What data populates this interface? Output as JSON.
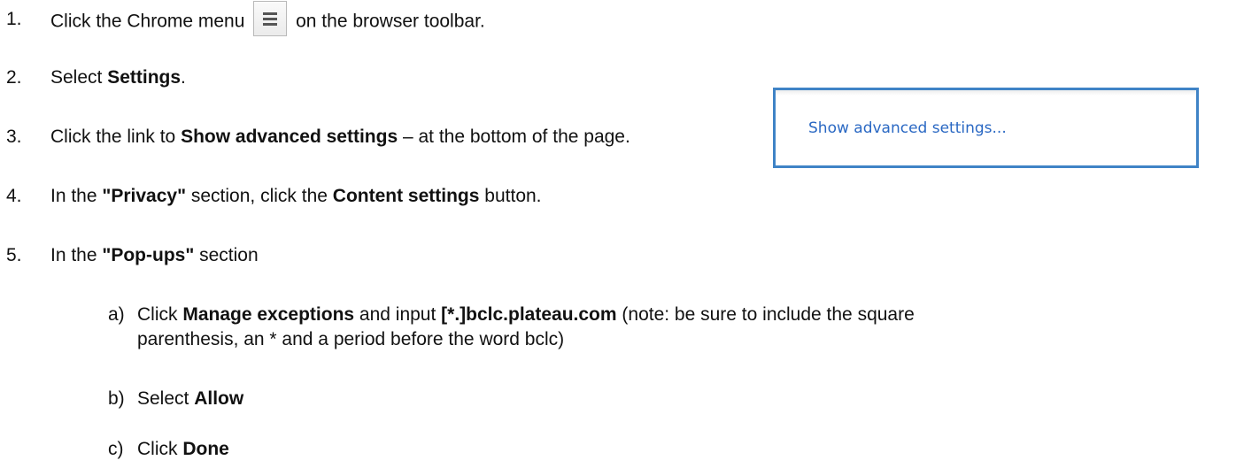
{
  "steps": [
    {
      "number": "1.",
      "prefix": "Click the Chrome menu",
      "suffix": "on the browser toolbar."
    },
    {
      "number": "2.",
      "prefix": "Select ",
      "bold": "Settings",
      "suffix": "."
    },
    {
      "number": "3.",
      "prefix": "Click the link to ",
      "bold": "Show advanced settings",
      "suffix": " – at the bottom of the page."
    },
    {
      "number": "4.",
      "prefix": "In the ",
      "bold1": "\"Privacy\"",
      "middle": " section, click the ",
      "bold2": "Content settings",
      "suffix": " button."
    },
    {
      "number": "5.",
      "prefix": "In the ",
      "bold": "\"Pop-ups\"",
      "suffix": " section"
    }
  ],
  "substeps": [
    {
      "letter": "a)",
      "prefix": "Click ",
      "bold1": "Manage exceptions",
      "middle": " and input ",
      "bold2": "[*.]bclc.plateau.com",
      "suffix": " (note: be sure to include the square",
      "continuation": "parenthesis, an * and a period before the word bclc)"
    },
    {
      "letter": "b)",
      "prefix": "Select ",
      "bold": "Allow"
    },
    {
      "letter": "c)",
      "prefix": "Click ",
      "bold": "Done"
    }
  ],
  "menu_icon": "hamburger-menu-icon",
  "advanced_link_label": "Show advanced settings...",
  "colors": {
    "highlight_border": "#3f83c6",
    "link": "#2a68c3"
  }
}
